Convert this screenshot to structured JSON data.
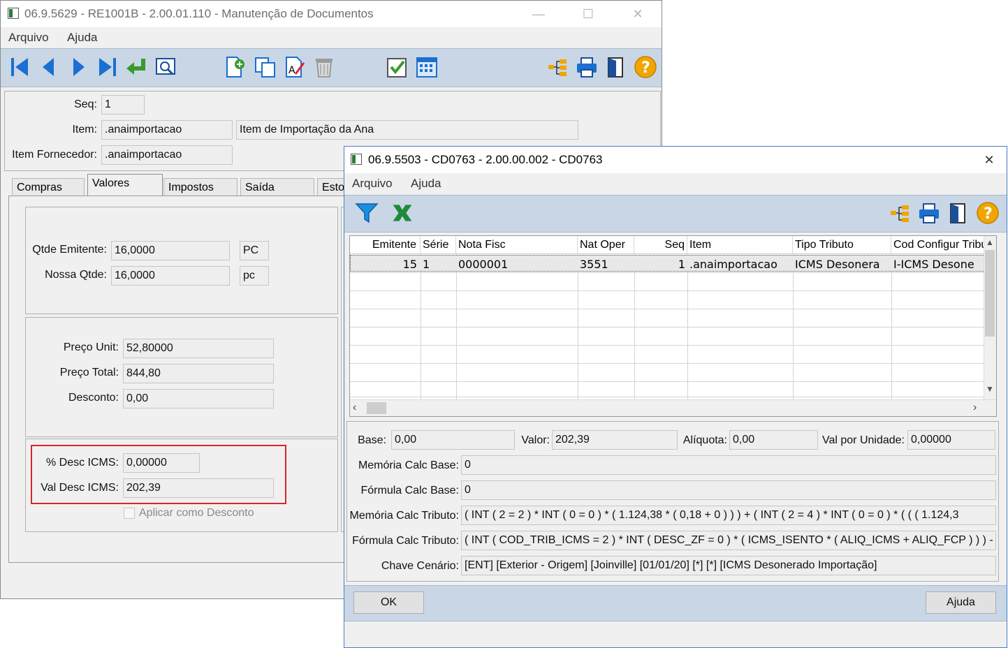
{
  "main_window": {
    "title": "06.9.5629 - RE1001B - 2.00.01.110 - Manutenção de Documentos",
    "menu": [
      "Arquivo",
      "Ajuda"
    ],
    "fields": {
      "seq_label": "Seq:",
      "seq_value": "1",
      "item_label": "Item:",
      "item_value": ".anaimportacao",
      "item_desc": "Item de Importação da Ana",
      "item_fornecedor_label": "Item Fornecedor:",
      "item_fornecedor_value": ".anaimportacao"
    },
    "tabs": [
      "Compras",
      "Valores",
      "Impostos",
      "Saída",
      "Esto"
    ],
    "active_tab": "Valores",
    "qtd": {
      "qtde_emitente_label": "Qtde Emitente:",
      "qtde_emitente_value": "16,0000",
      "qtde_emitente_unit": "PC",
      "nossa_qtde_label": "Nossa Qtde:",
      "nossa_qtde_value": "16,0000",
      "nossa_qtde_unit": "pc"
    },
    "precos": {
      "preco_unit_label": "Preço Unit:",
      "preco_unit_value": "52,80000",
      "preco_total_label": "Preço Total:",
      "preco_total_value": "844,80",
      "desconto_label": "Desconto:",
      "desconto_value": "0,00"
    },
    "icms": {
      "perc_desc_label": "% Desc ICMS:",
      "perc_desc_value": "0,00000",
      "val_desc_label": "Val Desc ICMS:",
      "val_desc_value": "202,39",
      "aplicar_label": "Aplicar como Desconto"
    }
  },
  "dialog": {
    "title": "06.9.5503 - CD0763 - 2.00.00.002 - CD0763",
    "menu": [
      "Arquivo",
      "Ajuda"
    ],
    "grid": {
      "columns": [
        "Emitente",
        "Série",
        "Nota Fisc",
        "Nat Oper",
        "Seq",
        "Item",
        "Tipo Tributo",
        "Cod Configur Tribu"
      ],
      "rows": [
        [
          "15",
          "1",
          "0000001",
          "3551",
          "1",
          ".anaimportacao",
          "ICMS Desonera",
          "I-ICMS Desone"
        ]
      ]
    },
    "details": {
      "base_label": "Base:",
      "base_value": "0,00",
      "valor_label": "Valor:",
      "valor_value": "202,39",
      "aliquota_label": "Alíquota:",
      "aliquota_value": "0,00",
      "val_unidade_label": "Val por Unidade:",
      "val_unidade_value": "0,00000",
      "memoria_base_label": "Memória Calc Base:",
      "memoria_base_value": "0",
      "formula_base_label": "Fórmula Calc Base:",
      "formula_base_value": "0",
      "memoria_tributo_label": "Memória Calc Tributo:",
      "memoria_tributo_value": "( INT ( 2 = 2 ) * INT ( 0 = 0 ) * ( 1.124,38 * ( 0,18 + 0 ) ) ) + ( INT ( 2 = 4 ) * INT ( 0 = 0 ) * ( ( ( 1.124,3",
      "formula_tributo_label": "Fórmula Calc Tributo:",
      "formula_tributo_value": "( INT ( COD_TRIB_ICMS = 2 ) * INT ( DESC_ZF = 0 ) * ( ICMS_ISENTO * ( ALIQ_ICMS + ALIQ_FCP ) ) ) -",
      "chave_label": "Chave Cenário:",
      "chave_value": "[ENT] [Exterior - Origem] [Joinville] [01/01/20] [*] [*] [ICMS Desonerado Importação]"
    },
    "buttons": {
      "ok": "OK",
      "ajuda": "Ajuda"
    }
  },
  "colors": {
    "toolbar_bg": "#c9d6e6",
    "highlight_border": "#d9252b",
    "help_icon": "#f0a500"
  }
}
